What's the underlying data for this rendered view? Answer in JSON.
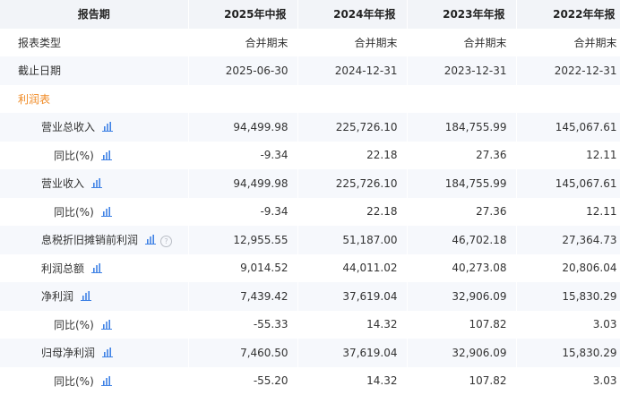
{
  "header": {
    "col0": "报告期",
    "periods": [
      "2025年中报",
      "2024年年报",
      "2023年年报",
      "2022年年报"
    ]
  },
  "rows": {
    "report_type": {
      "label": "报表类型",
      "values": [
        "合并期末",
        "合并期末",
        "合并期末",
        "合并期末"
      ]
    },
    "end_date": {
      "label": "截止日期",
      "values": [
        "2025-06-30",
        "2024-12-31",
        "2023-12-31",
        "2022-12-31"
      ]
    },
    "section_income": {
      "label": "利润表"
    },
    "total_revenue": {
      "label": "营业总收入",
      "values": [
        "94,499.98",
        "225,726.10",
        "184,755.99",
        "145,067.61"
      ]
    },
    "total_revenue_yoy": {
      "label": "同比(%)",
      "values": [
        "-9.34",
        "22.18",
        "27.36",
        "12.11"
      ]
    },
    "revenue": {
      "label": "营业收入",
      "values": [
        "94,499.98",
        "225,726.10",
        "184,755.99",
        "145,067.61"
      ]
    },
    "revenue_yoy": {
      "label": "同比(%)",
      "values": [
        "-9.34",
        "22.18",
        "27.36",
        "12.11"
      ]
    },
    "ebitda": {
      "label": "息税折旧摊销前利润",
      "values": [
        "12,955.55",
        "51,187.00",
        "46,702.18",
        "27,364.73"
      ]
    },
    "total_profit": {
      "label": "利润总额",
      "values": [
        "9,014.52",
        "44,011.02",
        "40,273.08",
        "20,806.04"
      ]
    },
    "net_profit": {
      "label": "净利润",
      "values": [
        "7,439.42",
        "37,619.04",
        "32,906.09",
        "15,830.29"
      ]
    },
    "net_profit_yoy": {
      "label": "同比(%)",
      "values": [
        "-55.33",
        "14.32",
        "107.82",
        "3.03"
      ]
    },
    "parent_net_profit": {
      "label": "归母净利润",
      "values": [
        "7,460.50",
        "37,619.04",
        "32,906.09",
        "15,830.29"
      ]
    },
    "parent_net_profit_yoy": {
      "label": "同比(%)",
      "values": [
        "-55.20",
        "14.32",
        "107.82",
        "3.03"
      ]
    }
  },
  "icons": {
    "chart": "bar-chart-icon",
    "help": "question-circle-icon",
    "help_glyph": "?"
  },
  "colors": {
    "header_bg": "#f2f4f8",
    "stripe_bg": "#f6f8fc",
    "section_orange": "#f08a24",
    "icon_blue": "#3f82e5"
  }
}
